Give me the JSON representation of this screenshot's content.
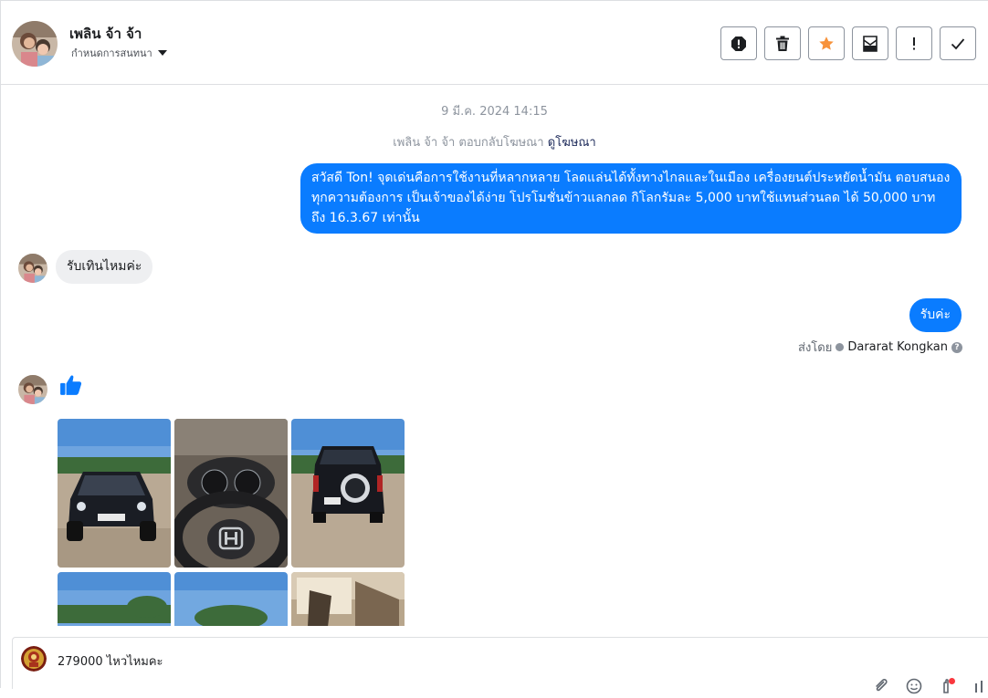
{
  "header": {
    "contact_name": "เพลิน จ้า จ้า",
    "assign_label": "กำหนดการสนทนา",
    "actions": [
      {
        "icon": "report-icon"
      },
      {
        "icon": "trash-icon"
      },
      {
        "icon": "star-icon"
      },
      {
        "icon": "mark-unread-icon"
      },
      {
        "icon": "important-icon"
      },
      {
        "icon": "check-icon"
      }
    ]
  },
  "thread": {
    "date": "9 มี.ค. 2024 14:15",
    "ad_reply_text": "เพลิน จ้า จ้า ตอบกลับโฆษณา",
    "ad_reply_link": "ดูโฆษณา",
    "messages": [
      {
        "direction": "out",
        "text": "สวัสดี Ton! จุดเด่นคือการใช้งานที่หลากหลาย โลดแล่นได้ทั้งทางไกลและในเมือง เครื่องยนต์ประหยัดน้ำมัน ตอบสนองทุกความต้องการ เป็นเจ้าของได้ง่าย โปรโมชั่นข้าวแลกลด กิโลกรัมละ 5,000 บาทใช้แทนส่วนลด ได้ 50,000 บาท ถึง 16.3.67 เท่านั้น"
      },
      {
        "direction": "in",
        "text": "รับเทินไหมค่ะ"
      },
      {
        "direction": "out",
        "text": "รับค่ะ"
      },
      {
        "direction": "in",
        "type": "like"
      }
    ],
    "sent_by_label": "ส่งโดย",
    "sent_by_agent": "Dararat Kongkan",
    "photos": [
      "car-front",
      "steering-wheel",
      "car-rear",
      "sky",
      "sky",
      "car-interior"
    ]
  },
  "composer": {
    "text": "279000 ไหวไหมคะ"
  },
  "colors": {
    "outgoing_bubble": "#0a7cff",
    "incoming_bubble": "#eeeff1",
    "star": "#f7923a",
    "notification_dot": "#fa383e"
  }
}
